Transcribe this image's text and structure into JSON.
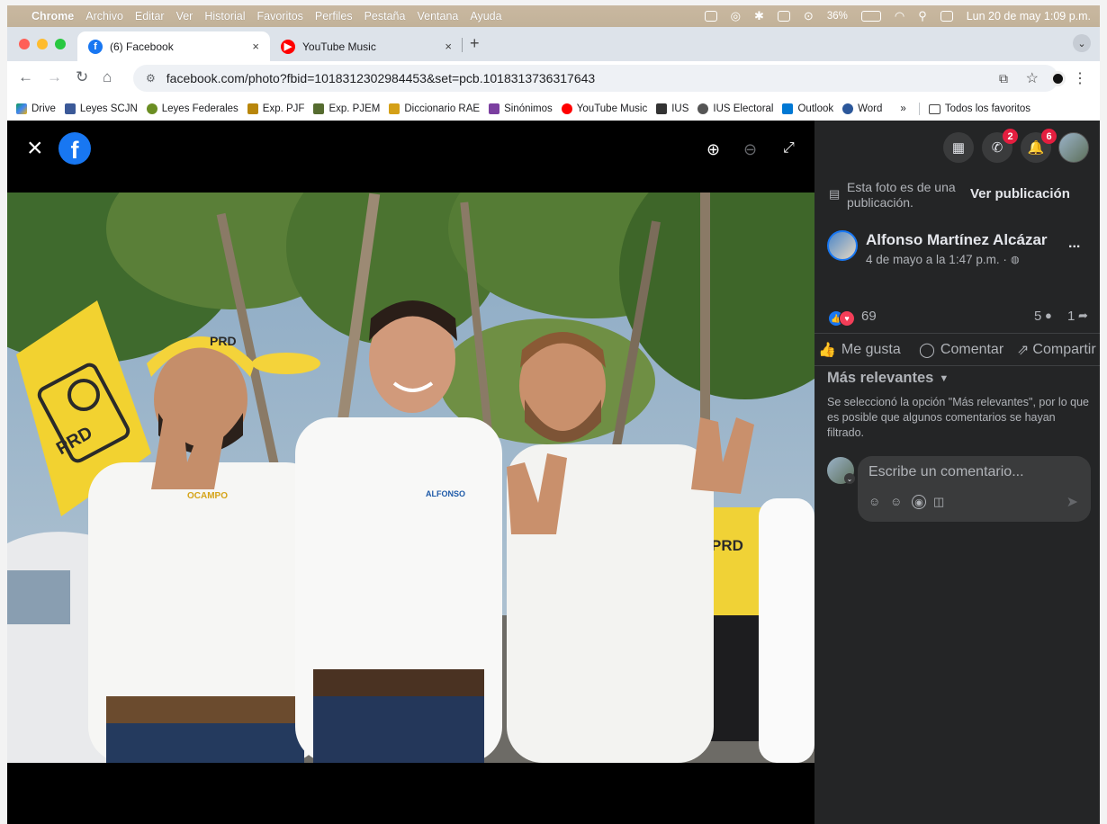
{
  "menubar": {
    "app": "Chrome",
    "items": [
      "Archivo",
      "Editar",
      "Ver",
      "Historial",
      "Favoritos",
      "Perfiles",
      "Pestaña",
      "Ventana",
      "Ayuda"
    ],
    "battery": "36%",
    "datetime": "Lun 20 de may  1:09 p.m."
  },
  "tabs": [
    {
      "title": "(6) Facebook",
      "close": "×"
    },
    {
      "title": "YouTube Music",
      "close": "×"
    }
  ],
  "new_tab": "+",
  "url": "facebook.com/photo?fbid=1018312302984453&set=pcb.1018313736317643",
  "bookmarks": [
    "Drive",
    "Leyes SCJN",
    "Leyes Federales",
    "Exp. PJF",
    "Exp. PJEM",
    "Diccionario RAE",
    "Sinónimos",
    "YouTube Music",
    "IUS",
    "IUS Electoral",
    "Outlook",
    "Word"
  ],
  "bookmarks_more": "»",
  "all_bookmarks": "Todos los favoritos",
  "viewer": {
    "close": "×"
  },
  "photo": {
    "flag_text": "PRD",
    "cap_text": "PRD",
    "shirt_left": "OCAMPO",
    "shirt_center": "ALFONSO",
    "bg_shirt_text": "PRD"
  },
  "header_badges": {
    "messenger": "2",
    "notifications": "6"
  },
  "sidebar": {
    "notice": "Esta foto es de una publicación.",
    "view_post": "Ver publicación",
    "author": "Alfonso Martínez Alcázar",
    "date": "4 de mayo a la 1:47 p.m. · ",
    "more": "...",
    "reactions": "69",
    "comments_count": "5",
    "shares_count": "1",
    "like": "Me gusta",
    "comment": "Comentar",
    "share": "Compartir",
    "sort": "Más relevantes",
    "sort_note": "Se seleccionó la opción \"Más relevantes\", por lo que es posible que algunos comentarios se hayan filtrado.",
    "comment_placeholder": "Escribe un comentario..."
  }
}
